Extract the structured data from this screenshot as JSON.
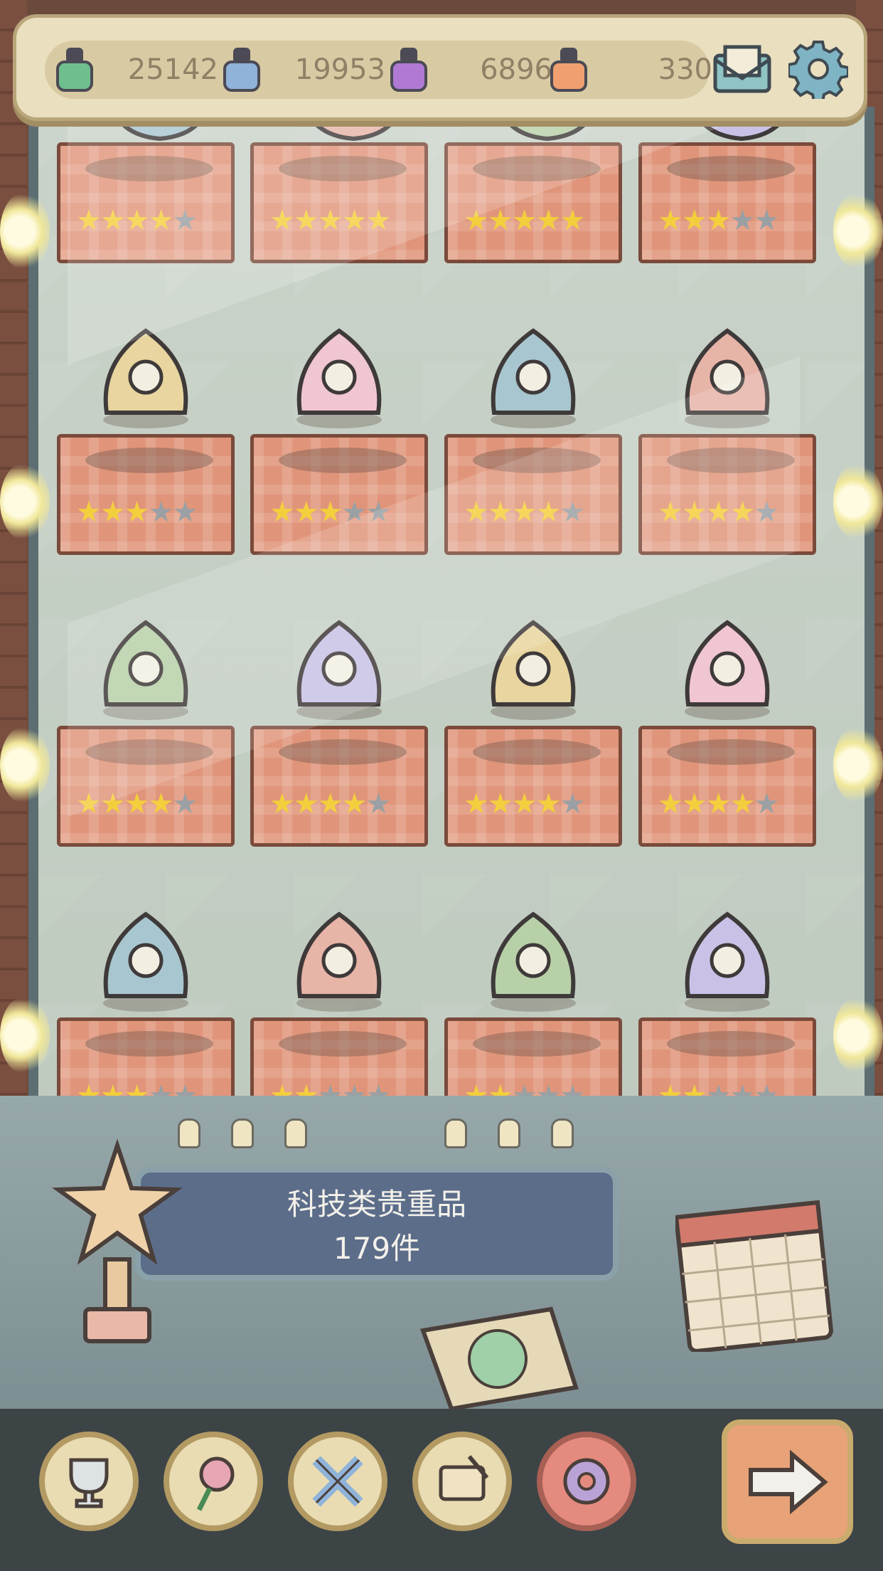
{
  "resources": [
    {
      "icon": "ink-bottle-green-icon",
      "color": "#6fbf8e",
      "value": "25142"
    },
    {
      "icon": "ink-bottle-blue-icon",
      "color": "#8fb3d9",
      "value": "19953"
    },
    {
      "icon": "ink-bottle-purple-icon",
      "color": "#b07ad4",
      "value": "6896"
    },
    {
      "icon": "ink-bottle-orange-icon",
      "color": "#f0a070",
      "value": "330"
    }
  ],
  "header_icons": [
    "mail-icon",
    "settings-gear-icon"
  ],
  "shelves": [
    {
      "items": [
        {
          "icon": "tape-roll-icon",
          "stars": 4
        },
        {
          "icon": "snow-globe-icon",
          "stars": 5
        },
        {
          "icon": "portal-device-icon",
          "stars": 5
        },
        {
          "icon": "satellite-robot-icon",
          "stars": 3
        }
      ]
    },
    {
      "items": [
        {
          "icon": "geodesic-sphere-icon",
          "stars": 3
        },
        {
          "icon": "3d-printer-icon",
          "stars": 3
        },
        {
          "icon": "nuclear-bomb-icon",
          "stars": 4
        },
        {
          "icon": "fighter-jet-icon",
          "stars": 4
        }
      ]
    },
    {
      "items": [
        {
          "icon": "dna-helix-icon",
          "stars": 4
        },
        {
          "icon": "space-capsule-icon",
          "stars": 4
        },
        {
          "icon": "robot-orb-icon",
          "stars": 4
        },
        {
          "icon": "blueprint-papers-icon",
          "stars": 4
        }
      ]
    },
    {
      "items": [
        {
          "icon": "circuit-poster-icon",
          "stars": 3
        },
        {
          "icon": "ancient-scroll-icon",
          "stars": 2
        },
        {
          "icon": "ufo-spaceship-icon",
          "stars": 2
        },
        {
          "icon": "formula-paper-icon",
          "stars": 2
        }
      ]
    }
  ],
  "plaque": {
    "title": "科技类贵重品",
    "count": "179件"
  },
  "nav": [
    {
      "icon": "trophy-cup-icon",
      "active": false
    },
    {
      "icon": "rose-flower-icon",
      "active": false
    },
    {
      "icon": "crossed-tools-icon",
      "active": false
    },
    {
      "icon": "scroll-quill-icon",
      "active": false
    },
    {
      "icon": "gear-icon",
      "active": true
    }
  ],
  "next_button_icon": "right-arrow-icon"
}
